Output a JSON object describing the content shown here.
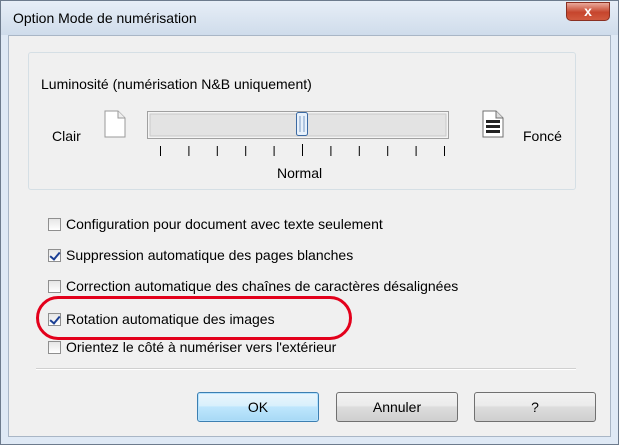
{
  "window": {
    "title": "Option Mode de numérisation",
    "close_glyph": "x"
  },
  "brightness": {
    "group_label": "Luminosité (numérisation N&B uniquement)",
    "left_label": "Clair",
    "right_label": "Foncé",
    "center_label": "Normal",
    "tick_count": 11,
    "value_index": 5
  },
  "options": [
    {
      "label": "Configuration pour document avec texte seulement",
      "checked": false
    },
    {
      "label": "Suppression automatique des pages blanches",
      "checked": true
    },
    {
      "label": "Correction automatique des chaînes de caractères désalignées",
      "checked": false
    },
    {
      "label": "Rotation automatique des images",
      "checked": true
    },
    {
      "label": "Orientez le côté à numériser vers l'extérieur",
      "checked": false
    }
  ],
  "buttons": {
    "ok": "OK",
    "cancel": "Annuler",
    "help": "?"
  },
  "colors": {
    "highlight": "#e3001b",
    "checkmark": "#1c3f94"
  }
}
